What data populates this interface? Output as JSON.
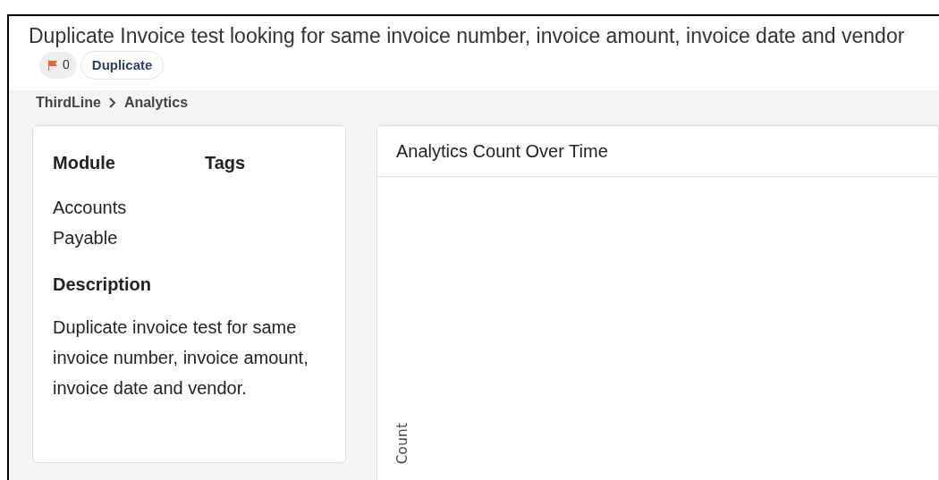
{
  "header": {
    "title": "Duplicate Invoice test looking for same invoice number, invoice amount, invoice date and vendor",
    "flag_count": "0",
    "tag": "Duplicate"
  },
  "breadcrumb": [
    "ThirdLine",
    "Analytics"
  ],
  "details": {
    "module_label": "Module",
    "module_value": "Accounts Payable",
    "tags_label": "Tags",
    "description_label": "Description",
    "description": "Duplicate invoice test for same invoice number, invoice amount, invoice date and vendor."
  },
  "chart_panel": {
    "title": "Analytics Count Over Time",
    "y_axis_label": "Count"
  }
}
